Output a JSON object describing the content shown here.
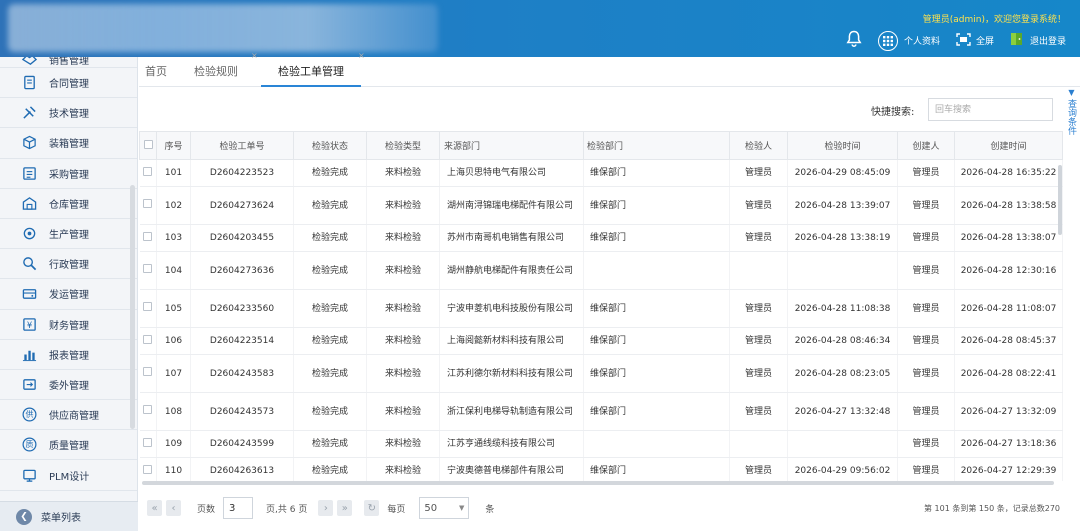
{
  "header": {
    "welcome": "管理员(admin)，欢迎您登录系统！",
    "profile_label": "个人资料",
    "fullscreen_label": "全屏",
    "logout_label": "退出登录"
  },
  "sidebar": {
    "items": [
      {
        "label": "销售管理",
        "icon": "handshake-icon"
      },
      {
        "label": "合同管理",
        "icon": "contract-icon"
      },
      {
        "label": "技术管理",
        "icon": "tools-icon"
      },
      {
        "label": "装箱管理",
        "icon": "box-icon"
      },
      {
        "label": "采购管理",
        "icon": "purchase-icon"
      },
      {
        "label": "仓库管理",
        "icon": "warehouse-icon"
      },
      {
        "label": "生产管理",
        "icon": "production-icon"
      },
      {
        "label": "行政管理",
        "icon": "admin-icon"
      },
      {
        "label": "发运管理",
        "icon": "shipping-icon"
      },
      {
        "label": "财务管理",
        "icon": "finance-icon"
      },
      {
        "label": "报表管理",
        "icon": "report-icon"
      },
      {
        "label": "委外管理",
        "icon": "outsource-icon"
      },
      {
        "label": "供应商管理",
        "icon": "supplier-icon",
        "glyph": "供"
      },
      {
        "label": "质量管理",
        "icon": "quality-icon",
        "glyph": "质"
      },
      {
        "label": "PLM设计",
        "icon": "plm-icon"
      }
    ],
    "menu_list_label": "菜单列表"
  },
  "tabs": [
    {
      "label": "首页"
    },
    {
      "label": "检验规则"
    },
    {
      "label": "检验工单管理"
    }
  ],
  "search": {
    "label": "快捷搜索:",
    "placeholder": "回车搜索"
  },
  "query_panel_label": "查询条件",
  "table": {
    "columns": [
      "序号",
      "检验工单号",
      "检验状态",
      "检验类型",
      "来源部门",
      "检验部门",
      "检验人",
      "检验时间",
      "创建人",
      "创建时间"
    ],
    "rows": [
      [
        "101",
        "D2604223523",
        "检验完成",
        "来料检验",
        "上海贝思特电气有限公司",
        "维保部门",
        "管理员",
        "2026-04-29 08:45:09",
        "管理员",
        "2026-04-28 16:35:22"
      ],
      [
        "102",
        "D2604273624",
        "检验完成",
        "来料检验",
        "湖州南浔锦瑞电梯配件有限公司",
        "维保部门",
        "管理员",
        "2026-04-28 13:39:07",
        "管理员",
        "2026-04-28 13:38:58"
      ],
      [
        "103",
        "D2604203455",
        "检验完成",
        "来料检验",
        "苏州市南哥机电销售有限公司",
        "维保部门",
        "管理员",
        "2026-04-28 13:38:19",
        "管理员",
        "2026-04-28 13:38:07"
      ],
      [
        "104",
        "D2604273636",
        "检验完成",
        "来料检验",
        "湖州静航电梯配件有限责任公司",
        "",
        "",
        "",
        "管理员",
        "2026-04-28 12:30:16"
      ],
      [
        "105",
        "D2604233560",
        "检验完成",
        "来料检验",
        "宁波申菱机电科技股份有限公司",
        "维保部门",
        "管理员",
        "2026-04-28 11:08:38",
        "管理员",
        "2026-04-28 11:08:07"
      ],
      [
        "106",
        "D2604223514",
        "检验完成",
        "来料检验",
        "上海阅懿新材料科技有限公司",
        "维保部门",
        "管理员",
        "2026-04-28 08:46:34",
        "管理员",
        "2026-04-28 08:45:37"
      ],
      [
        "107",
        "D2604243583",
        "检验完成",
        "来料检验",
        "江苏利德尔新材料科技有限公司",
        "维保部门",
        "管理员",
        "2026-04-28 08:23:05",
        "管理员",
        "2026-04-28 08:22:41"
      ],
      [
        "108",
        "D2604243573",
        "检验完成",
        "来料检验",
        "浙江保利电梯导轨制造有限公司",
        "维保部门",
        "管理员",
        "2026-04-27 13:32:48",
        "管理员",
        "2026-04-27 13:32:09"
      ],
      [
        "109",
        "D2604243599",
        "检验完成",
        "来料检验",
        "江苏亨通线缆科技有限公司",
        "",
        "",
        "",
        "管理员",
        "2026-04-27 13:18:36"
      ],
      [
        "110",
        "D2604263613",
        "检验完成",
        "来料检验",
        "宁波奥德普电梯部件有限公司",
        "维保部门",
        "管理员",
        "2026-04-29 09:56:02",
        "管理员",
        "2026-04-27 12:29:39"
      ]
    ]
  },
  "pager": {
    "page_label": "页数",
    "page_value": "3",
    "total_pages_text": "页,共 6 页",
    "per_page_label": "每页",
    "page_size": "50",
    "unit_label": "条",
    "info": "第 101 条到第 150 条，记录总数270"
  }
}
